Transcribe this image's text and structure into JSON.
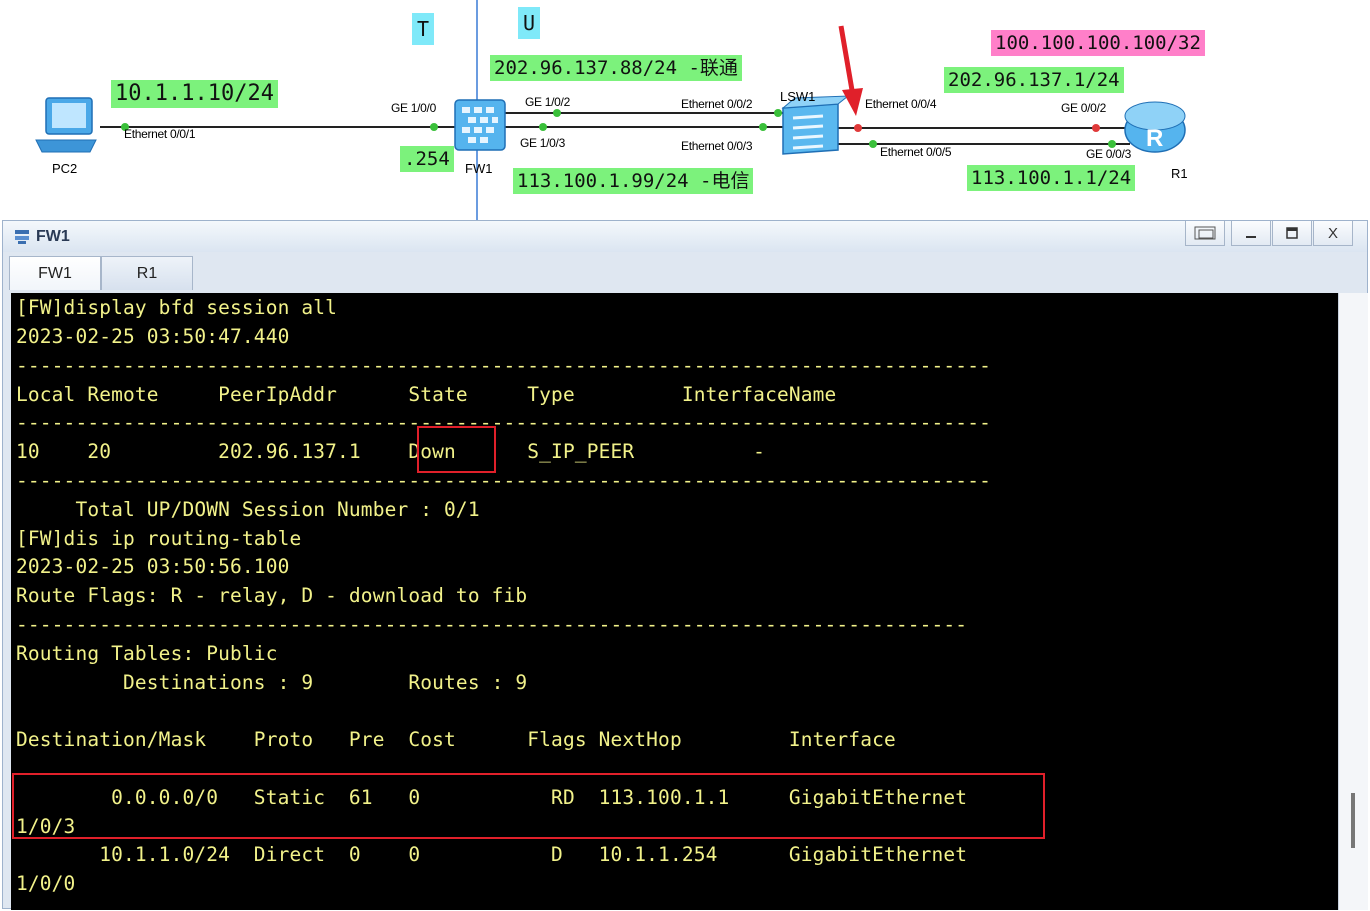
{
  "topology": {
    "labels": {
      "pc2": "PC2",
      "fw1": "FW1",
      "lsw1": "LSW1",
      "r1": "R1"
    },
    "ports": {
      "pc_eth": "Ethernet 0/0/1",
      "fw_ge100": "GE 1/0/0",
      "fw_ge102": "GE 1/0/2",
      "fw_ge103": "GE 1/0/3",
      "sw_eth002": "Ethernet 0/0/2",
      "sw_eth003": "Ethernet 0/0/3",
      "sw_eth004": "Ethernet 0/0/4",
      "sw_eth005": "Ethernet 0/0/5",
      "r_ge002": "GE 0/0/2",
      "r_ge003": "GE 0/0/3"
    },
    "tags": {
      "pc_ip": "10.1.1.10/24",
      "fw_inside": ".254",
      "zone_t": "T",
      "zone_u": "U",
      "unicom": "202.96.137.88/24 -联通",
      "telecom": "113.100.1.99/24 -电信",
      "loopback": "100.100.100.100/32",
      "r_unicom": "202.96.137.1/24",
      "r_telecom": "113.100.1.1/24"
    },
    "colors": {
      "green": "#7cf27c",
      "pink": "#ff7fc9",
      "cyan": "#7fe9f9",
      "arrow": "#e0202a"
    }
  },
  "window": {
    "title": "FW1",
    "icon": "device-icon",
    "controls": [
      "restore-icon",
      "minimize-icon",
      "maximize-icon",
      "close-icon"
    ],
    "close_label": "X",
    "tabs": [
      {
        "label": "FW1",
        "active": true
      },
      {
        "label": "R1",
        "active": false
      }
    ]
  },
  "console": {
    "text_color": "#f2f28a",
    "lines": [
      "[FW]display bfd session all",
      "2023-02-25 03:50:47.440",
      "----------------------------------------------------------------------------------",
      "Local Remote     PeerIpAddr      State     Type         InterfaceName",
      "----------------------------------------------------------------------------------",
      "10    20         202.96.137.1    Down      S_IP_PEER          -",
      "----------------------------------------------------------------------------------",
      "     Total UP/DOWN Session Number : 0/1",
      "[FW]dis ip routing-table",
      "2023-02-25 03:50:56.100",
      "Route Flags: R - relay, D - download to fib",
      "--------------------------------------------------------------------------------",
      "Routing Tables: Public",
      "         Destinations : 9        Routes : 9",
      "",
      "Destination/Mask    Proto   Pre  Cost      Flags NextHop         Interface",
      "",
      "        0.0.0.0/0   Static  61   0           RD  113.100.1.1     GigabitEthernet",
      "1/0/3",
      "       10.1.1.0/24  Direct  0    0           D   10.1.1.254      GigabitEthernet",
      "1/0/0"
    ]
  }
}
